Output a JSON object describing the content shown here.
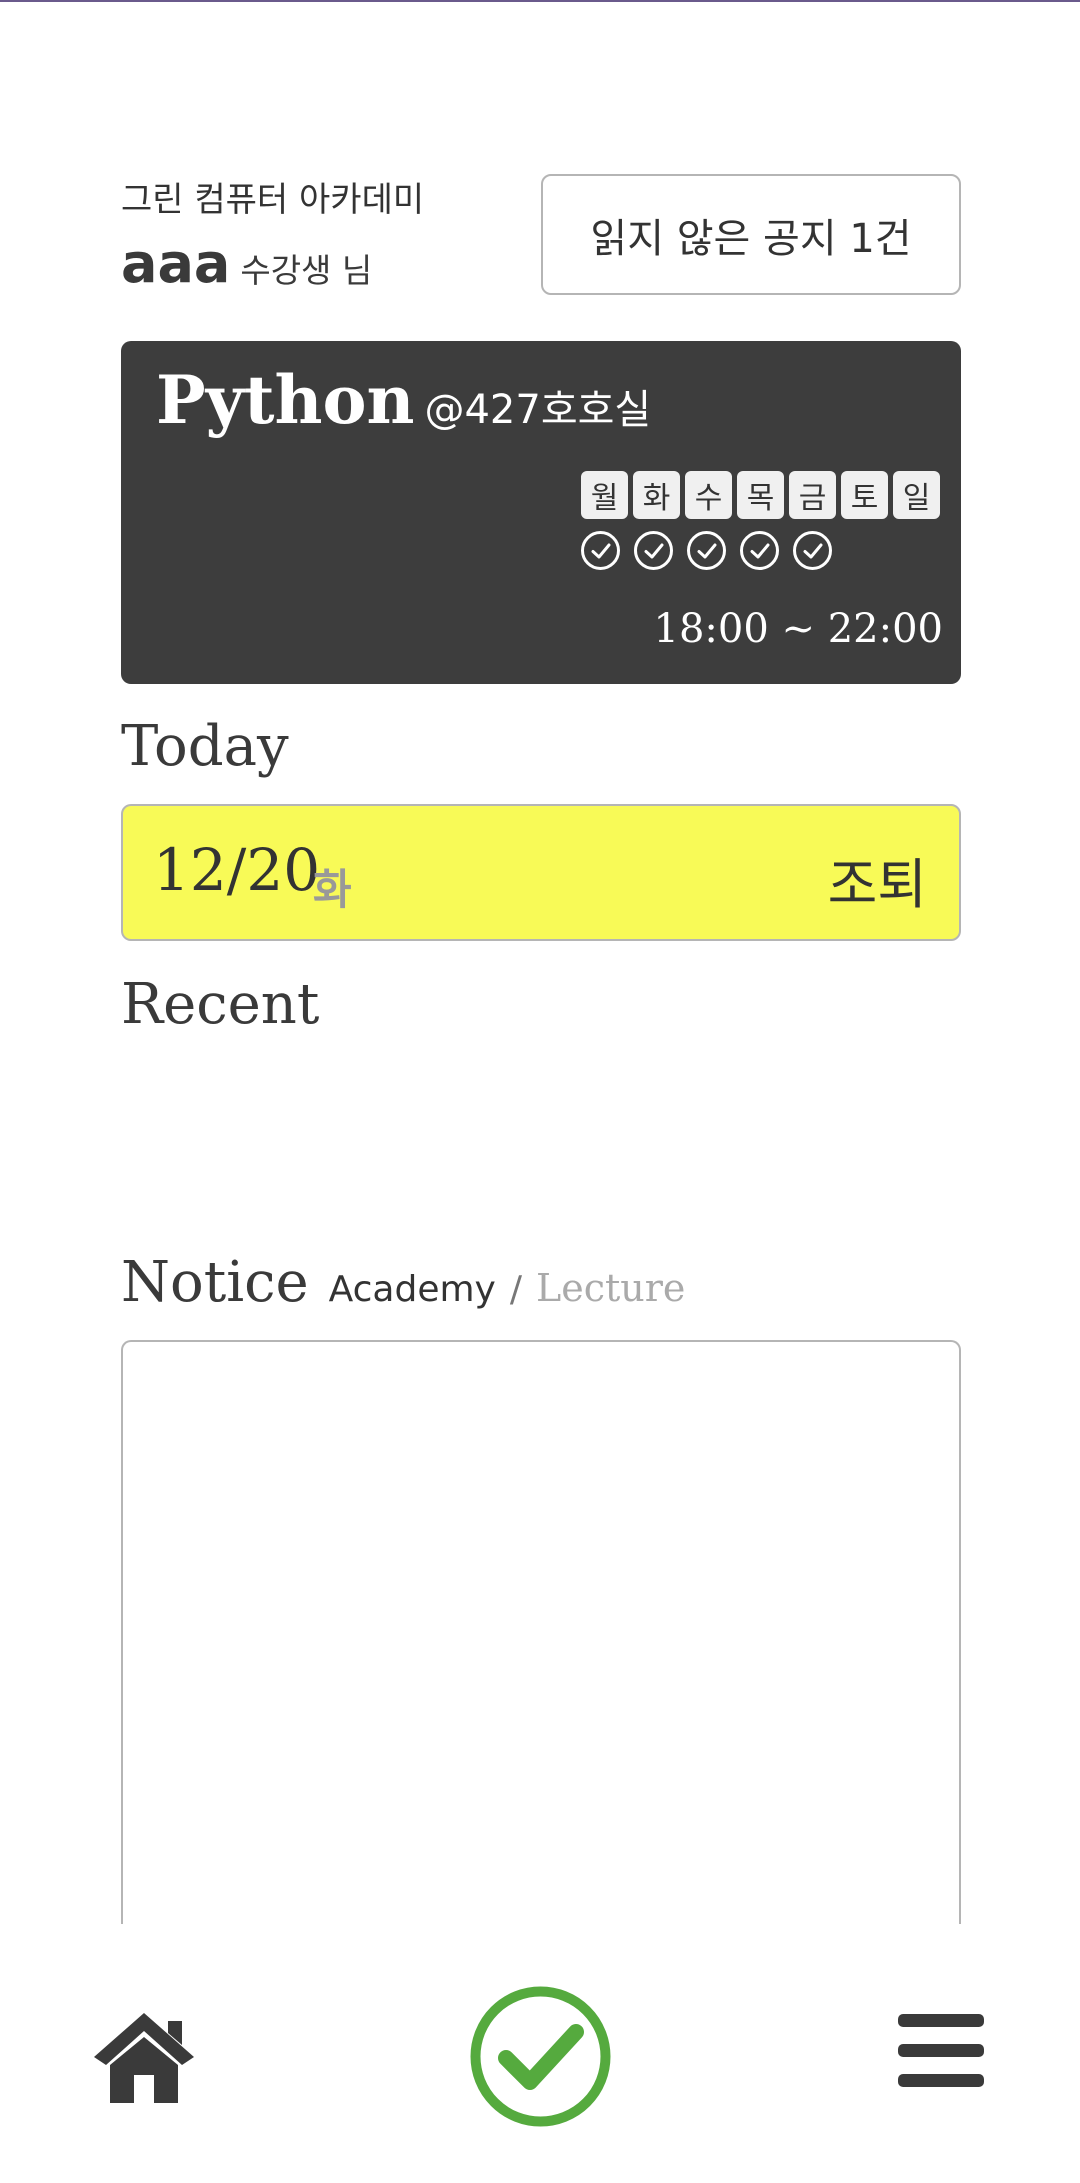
{
  "header": {
    "academy_name": "그린 컴퓨터 아카데미",
    "user_name": "aaa",
    "user_suffix": "수강생 님",
    "unread_notice_label": "읽지 않은 공지 1건"
  },
  "class_card": {
    "course": "Python",
    "room": "@427호호실",
    "days": [
      "월",
      "화",
      "수",
      "목",
      "금",
      "토",
      "일"
    ],
    "active_days": [
      "월",
      "화",
      "수",
      "목",
      "금"
    ],
    "time": "18:00 ~ 22:00",
    "background_color": "#3d3d3d"
  },
  "today": {
    "title": "Today",
    "date": "12/20",
    "weekday": "화",
    "lookup_label": "조퇴",
    "highlight_color": "#f8fa57"
  },
  "recent": {
    "title": "Recent"
  },
  "notice": {
    "title": "Notice",
    "tab_academy": "Academy",
    "separator": "/",
    "tab_lecture": "Lecture",
    "active_tab": "Academy"
  },
  "bottom_nav": {
    "items": [
      {
        "icon": "home-icon",
        "color": "#3a3a3a"
      },
      {
        "icon": "check-circle-icon",
        "color": "#55aa3e"
      },
      {
        "icon": "hamburger-menu-icon",
        "color": "#3a3a3a"
      }
    ]
  }
}
